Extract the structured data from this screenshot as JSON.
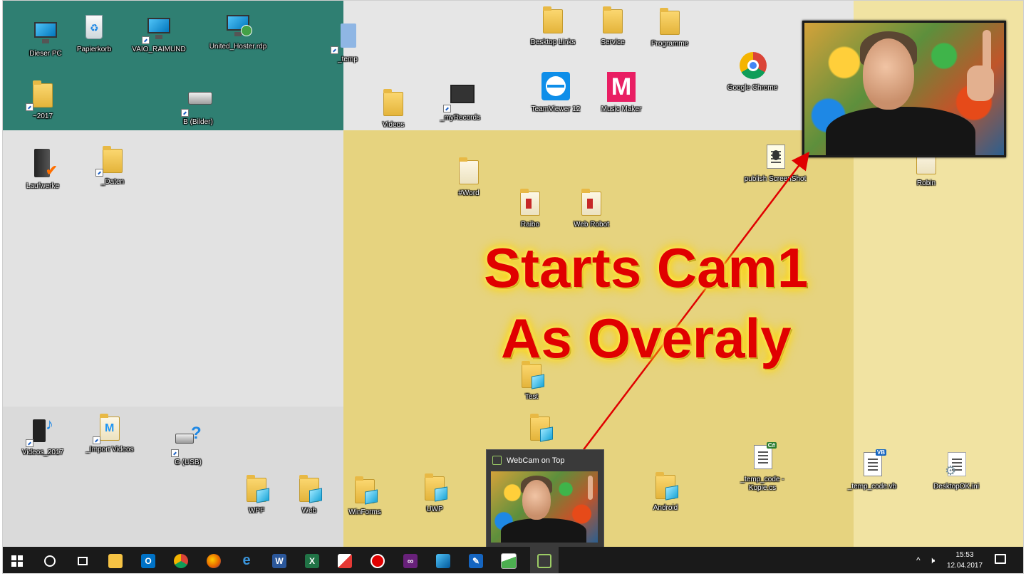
{
  "desktop": {
    "icons": [
      {
        "label": "Dieser PC"
      },
      {
        "label": "Papierkorb"
      },
      {
        "label": "VAIO_RAIMUND"
      },
      {
        "label": "United_Hoster.rdp"
      },
      {
        "label": "_temp"
      },
      {
        "label": "Desktop Links"
      },
      {
        "label": "Service"
      },
      {
        "label": "Programme"
      },
      {
        "label": "Google Chrome"
      },
      {
        "label": "~2017"
      },
      {
        "label": "B (Bilder)"
      },
      {
        "label": "Videos"
      },
      {
        "label": "_myRecords"
      },
      {
        "label": "TeamViewer 12"
      },
      {
        "label": "Music Maker"
      },
      {
        "label": "Laufwerke"
      },
      {
        "label": "_Daten"
      },
      {
        "label": "#Word"
      },
      {
        "label": "Raibo"
      },
      {
        "label": "Web Robot"
      },
      {
        "label": "publish ScreenShot"
      },
      {
        "label": "Robin"
      },
      {
        "label": "Test"
      },
      {
        "label": ""
      },
      {
        "label": "Videos_2017"
      },
      {
        "label": "_Import Videos"
      },
      {
        "label": "G (USB)"
      },
      {
        "label": "WPF"
      },
      {
        "label": "Web"
      },
      {
        "label": "WinForms"
      },
      {
        "label": "UWP"
      },
      {
        "label": "Android"
      },
      {
        "label": "_temp_code - Kopie.cs"
      },
      {
        "label": "_temp_code.vb"
      },
      {
        "label": "DesktopOK.ini"
      }
    ]
  },
  "overlay_window": {
    "title": "WebCam on Top"
  },
  "callout": {
    "line1": "Starts Cam1",
    "line2": "As Overaly",
    "color": "#e00000",
    "glow": "#ffd400"
  },
  "taskbar": {
    "apps": [
      {
        "name": "start-button",
        "glyph": "windows"
      },
      {
        "name": "search-button",
        "glyph": "circle"
      },
      {
        "name": "task-view-button",
        "glyph": "task-view"
      },
      {
        "name": "file-explorer",
        "glyph": "folder"
      },
      {
        "name": "outlook",
        "glyph": "O"
      },
      {
        "name": "chrome",
        "glyph": "chrome"
      },
      {
        "name": "firefox",
        "glyph": "firefox"
      },
      {
        "name": "edge",
        "glyph": "e"
      },
      {
        "name": "word",
        "glyph": "W"
      },
      {
        "name": "excel",
        "glyph": "X"
      },
      {
        "name": "app-red-box",
        "glyph": "box"
      },
      {
        "name": "recorder",
        "glyph": "record"
      },
      {
        "name": "visual-studio",
        "glyph": "vs"
      },
      {
        "name": "remote-desktop",
        "glyph": "rdp"
      },
      {
        "name": "pen-tool",
        "glyph": "pen"
      },
      {
        "name": "image-app",
        "glyph": "image"
      },
      {
        "name": "webcam-on-top",
        "glyph": "webcam"
      }
    ],
    "clock": {
      "time": "15:53",
      "date": "12.04.2017"
    }
  },
  "colors": {
    "teal": "#2f7f72",
    "yellow": "#e9d985",
    "grey": "#e4e4e4",
    "taskbar": "#1a1a1a",
    "arrow": "#e00000"
  }
}
